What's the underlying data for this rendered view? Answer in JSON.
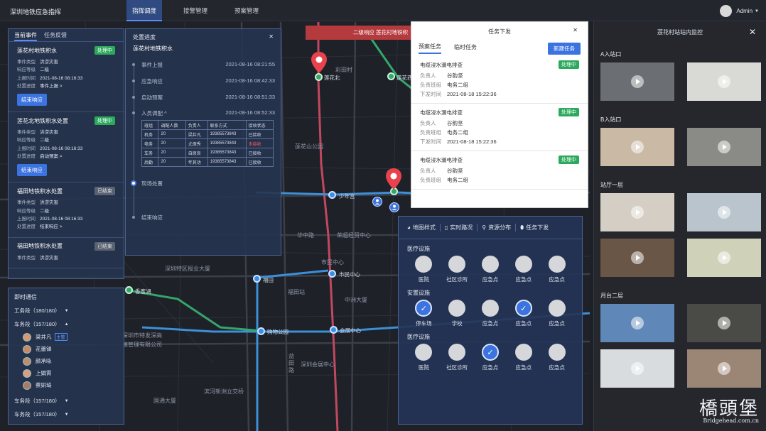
{
  "topbar": {
    "app_title": "深圳地铁应急指挥",
    "nav": [
      {
        "label": "指挥调度",
        "active": true
      },
      {
        "label": "接警管理",
        "active": false
      },
      {
        "label": "预案管理",
        "active": false
      }
    ],
    "user_name": "Admin"
  },
  "map": {
    "labels": [
      "彩田村",
      "莲花山公园",
      "华中路",
      "荣超经贸中心",
      "深圳特区报业大厦",
      "市民中心",
      "福田站",
      "中洲大厦",
      "深圳市特发深高",
      "速管理有限公司",
      "深圳会展中心",
      "滨河新洲立交桥",
      "国通大厦",
      "益田路"
    ],
    "stations": [
      "莲花北",
      "少年宫",
      "市民中心",
      "福田",
      "香蜜湖",
      "购物公园",
      "会展中心",
      "莲花西"
    ]
  },
  "alarm": {
    "text": "二级响应    莲花村地铁积"
  },
  "events": {
    "tabs": [
      "当前事件",
      "任务反馈"
    ],
    "field_labels": {
      "type": "事件类型",
      "level": "响应等级",
      "time": "上报时间",
      "progress": "处置进度"
    },
    "cards": [
      {
        "title": "莲花村地铁积水",
        "status": "处理中",
        "status_kind": "on",
        "type": "洪涝灾害",
        "level": "二级",
        "time": "2021-08-16 08:16:33",
        "progress": "事件上报 >",
        "button": "结束响应"
      },
      {
        "title": "莲花北地铁积水处置",
        "status": "处理中",
        "status_kind": "on",
        "type": "洪涝灾害",
        "level": "二级",
        "time": "2021-08-16 08:16:33",
        "progress": "启动预案 >",
        "button": "结束响应"
      },
      {
        "title": "福田地铁积水处置",
        "status": "已结束",
        "status_kind": "off",
        "type": "洪涝灾害",
        "level": "二级",
        "time": "2021-08-16 08:16:33",
        "progress": "结束响应 >"
      },
      {
        "title": "福田地铁积水处置",
        "status": "已结束",
        "status_kind": "off",
        "type": "洪涝灾害"
      }
    ]
  },
  "progress": {
    "title": "处置进度",
    "subtitle": "莲花村地铁积水",
    "steps": [
      {
        "label": "事件上报",
        "time": "2021-08-16 08:21:55"
      },
      {
        "label": "应急响应",
        "time": "2021-08-16 08:42:33"
      },
      {
        "label": "启动预案",
        "time": "2021-08-16 08:51:33"
      },
      {
        "label": "人员调配 ^",
        "time": "2021-08-16 08:52:33"
      },
      {
        "label": "现场处置",
        "time": ""
      },
      {
        "label": "结束响应",
        "time": ""
      }
    ],
    "table": {
      "headers": [
        "班组",
        "调配人数",
        "负责人",
        "联系方式",
        "接收状态"
      ],
      "rows": [
        [
          "机务",
          "20",
          "梁井凡",
          "19385573843",
          "已接收"
        ],
        [
          "电务",
          "20",
          "尤保秀",
          "19385573843",
          "未接收"
        ],
        [
          "车务",
          "20",
          "自原良",
          "19385573843",
          "已接收"
        ],
        [
          "后勤",
          "20",
          "年其功",
          "19385573843",
          "已接收"
        ]
      ]
    }
  },
  "comm": {
    "title": "即时通信",
    "groups": [
      {
        "label": "工务段（180/180）",
        "caret": "▼"
      },
      {
        "label": "车务段（157/180）",
        "caret": "▲"
      }
    ],
    "members": [
      {
        "name": "梁井凡",
        "tag": "主管"
      },
      {
        "name": "花蕾锑",
        "tag": ""
      },
      {
        "name": "颜承咏",
        "tag": ""
      },
      {
        "name": "上娟霄",
        "tag": ""
      },
      {
        "name": "蔡妍琦",
        "tag": ""
      }
    ],
    "groups_after": [
      {
        "label": "车务段（157/180）",
        "caret": "▼"
      },
      {
        "label": "车务段（157/180）",
        "caret": "▼"
      }
    ]
  },
  "tasks": {
    "title": "任务下发",
    "tabs": [
      "预案任务",
      "临时任务"
    ],
    "new_button": "新建任务",
    "field_labels": {
      "owner": "负责人",
      "team": "负责班组",
      "time": "下发时间"
    },
    "cards": [
      {
        "title": "电缆浸水漏电排查",
        "status": "处理中",
        "owner": "谷韵坚",
        "team": "电务二组",
        "time": "2021-08-18 15:22:36"
      },
      {
        "title": "电缆浸水漏电排查",
        "status": "处理中",
        "owner": "谷韵坚",
        "team": "电务二组",
        "time": "2021-08-18 15:22:36"
      },
      {
        "title": "电缆浸水漏电排查",
        "status": "处理中",
        "owner": "谷韵坚",
        "team": "电务二组",
        "time": ""
      }
    ]
  },
  "legend": {
    "tabs": [
      {
        "icon": "palette-icon",
        "glyph": "◕",
        "label": "地图样式"
      },
      {
        "icon": "traffic-light-icon",
        "glyph": "▯",
        "label": "实时路况"
      },
      {
        "icon": "search-icon",
        "glyph": "⚲",
        "label": "资源分布"
      },
      {
        "icon": "pin-icon",
        "glyph": "⬮",
        "label": "任务下发"
      }
    ],
    "sections": [
      {
        "title": "医疗设施",
        "items": [
          {
            "name": "医院",
            "checked": false
          },
          {
            "name": "社区诊所",
            "checked": false
          },
          {
            "name": "应急点",
            "checked": false
          },
          {
            "name": "应急点",
            "checked": false
          },
          {
            "name": "应急点",
            "checked": false
          }
        ]
      },
      {
        "title": "安置设施",
        "items": [
          {
            "name": "停车场",
            "checked": true
          },
          {
            "name": "学校",
            "checked": false
          },
          {
            "name": "应急点",
            "checked": false
          },
          {
            "name": "应急点",
            "checked": true
          },
          {
            "name": "应急点",
            "checked": false
          }
        ]
      },
      {
        "title": "医疗设施",
        "items": [
          {
            "name": "医院",
            "checked": false
          },
          {
            "name": "社区诊所",
            "checked": false
          },
          {
            "name": "应急点",
            "checked": true
          },
          {
            "name": "应急点",
            "checked": false
          },
          {
            "name": "应急点",
            "checked": false
          }
        ]
      }
    ]
  },
  "monitor": {
    "title": "莲花村站站内监控",
    "sections": [
      {
        "title": "A入站口",
        "thumbs": [
          {
            "bg": "#6b6e72"
          },
          {
            "bg": "#d9d9d6"
          }
        ]
      },
      {
        "title": "B入站口",
        "thumbs": [
          {
            "bg": "#c9b9a5"
          },
          {
            "bg": "#8a8a86"
          }
        ]
      },
      {
        "title": "站厅一层",
        "thumbs": [
          {
            "bg": "#d4cec4"
          },
          {
            "bg": "#b9c4cc"
          }
        ]
      },
      {
        "title": "",
        "thumbs": [
          {
            "bg": "#6a5647"
          },
          {
            "bg": "#cfd2b9"
          }
        ]
      },
      {
        "title": "月台二层",
        "thumbs": [
          {
            "bg": "#5f87b8"
          },
          {
            "bg": "#4a4a46"
          }
        ]
      },
      {
        "title": "",
        "thumbs": [
          {
            "bg": "#d9dcdf"
          },
          {
            "bg": "#9b8676"
          }
        ]
      }
    ]
  },
  "watermark": {
    "text": "橋頭堡",
    "sub": "Bridgehead.com.cn"
  }
}
